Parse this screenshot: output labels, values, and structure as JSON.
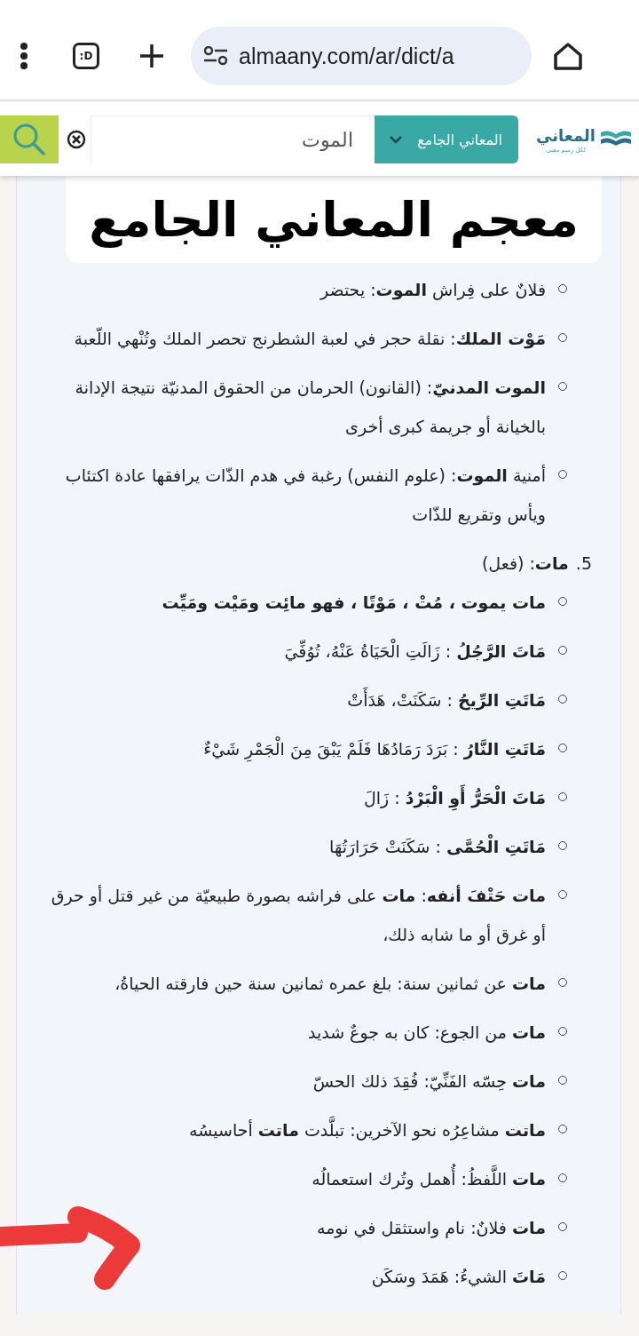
{
  "browser": {
    "tab_count": ":D",
    "url": "almaany.com/ar/dict/a"
  },
  "site_header": {
    "logo": "المعاني",
    "logo_tagline": "لكل رسم معنى",
    "dictionary_select": "المعاني الجامع",
    "search": {
      "value": "الموت"
    }
  },
  "banner": {
    "title": "معجم المعاني الجامع"
  },
  "entries": [
    {
      "text": "فلانٌ على فِراش **الموت**: يحتضر"
    },
    {
      "text": "**مَوْت الملك**: نقلة حجر في لعبة الشطرنج تحصر الملك وتُنْهي اللّعبة"
    },
    {
      "text": "**الموت المدنيّ**: (القانون) الحرمان من الحقوق المدنيّة نتيجة الإدانة بالخيانة أو جريمة كبرى أخرى"
    },
    {
      "text": "أمنية **الموت**: (علوم النفس) رغبة في هدم الذّات يرافقها عادة اكتئاب ويأس وتقريع للذّات"
    }
  ],
  "section": {
    "number": "5.",
    "heading": "**مات**: (فعل)",
    "items": [
      {
        "text": "**مات يموت ، مُتْ ، مَوْتًا ، فهو مائِت ومَيْت ومَيِّت**"
      },
      {
        "text": "**مَاتَ الرَّجُلُ** : زَالَتِ الْحَيَاةُ عَنْهُ، تُوُفِّيَ"
      },
      {
        "text": "**مَاتَتِ الرِّيحُ** : سَكَنَتْ، هَدَأَتْ"
      },
      {
        "text": "**مَاتَتِ النَّارُ** : بَرَدَ رَمَادُهَا فَلَمْ يَبْقَ مِنَ الْجَمْرِ شَيْءٌ"
      },
      {
        "text": "**مَاتَ الْحَرُّ أَوِ الْبَرْدُ** : زَالَ"
      },
      {
        "text": "**مَاتَتِ الْحُمَّى** : سَكَنَتْ حَرَارَتُهَا"
      },
      {
        "text": "**مات حَتْفَ أنفه**: **مات** على فراشه بصورة طبيعيّة من غير قتل أو حرق أو غرق أو ما شابه ذلك،"
      },
      {
        "text": "**مات** عن ثمانين سنة: بلغ عمره ثمانين سنة حين فارقته الحياةُ،"
      },
      {
        "text": "**مات** من الجوع: كان به جوعٌ شديد"
      },
      {
        "text": "**مات** حِسّه الفَنِّيّ: فُقِدَ ذلك الحسّ"
      },
      {
        "text": "**ماتت** مشاعِرُه نحو الآخرين: تبلَّدت **ماتت** أحاسيسُه"
      },
      {
        "text": "**مات** اللَّفظُ: أُهمل وتُرك استعمالُه"
      },
      {
        "text": "**مات** فلانٌ: نام واستثقل في نومه"
      },
      {
        "text": "**مَاتَ** الشيءُ: هَمَدَ وسَكَن"
      }
    ]
  }
}
